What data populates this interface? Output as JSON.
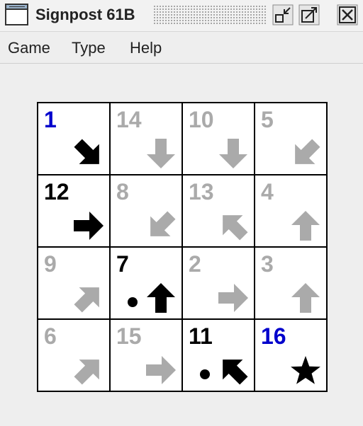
{
  "window": {
    "title": "Signpost 61B"
  },
  "menu": [
    "Game",
    "Type",
    "Help"
  ],
  "colors": {
    "given_number": "#0000cc",
    "placed_number": "#000000",
    "hint_number": "#aaaaaa",
    "given_arrow": "#000000",
    "hint_arrow": "#aaaaaa"
  },
  "board": {
    "cols": 4,
    "rows": 4,
    "cells": [
      {
        "num": "1",
        "kind": "given",
        "arrow": "se",
        "dot": false
      },
      {
        "num": "14",
        "kind": "hint",
        "arrow": "s",
        "dot": false
      },
      {
        "num": "10",
        "kind": "hint",
        "arrow": "s",
        "dot": false
      },
      {
        "num": "5",
        "kind": "hint",
        "arrow": "sw",
        "dot": false
      },
      {
        "num": "12",
        "kind": "placed",
        "arrow": "e",
        "dot": false
      },
      {
        "num": "8",
        "kind": "hint",
        "arrow": "sw",
        "dot": false
      },
      {
        "num": "13",
        "kind": "hint",
        "arrow": "nw",
        "dot": false
      },
      {
        "num": "4",
        "kind": "hint",
        "arrow": "n",
        "dot": false
      },
      {
        "num": "9",
        "kind": "hint",
        "arrow": "ne",
        "dot": false
      },
      {
        "num": "7",
        "kind": "placed",
        "arrow": "n",
        "dot": true
      },
      {
        "num": "2",
        "kind": "hint",
        "arrow": "e",
        "dot": false
      },
      {
        "num": "3",
        "kind": "hint",
        "arrow": "n",
        "dot": false
      },
      {
        "num": "6",
        "kind": "hint",
        "arrow": "ne",
        "dot": false
      },
      {
        "num": "15",
        "kind": "hint",
        "arrow": "e",
        "dot": false
      },
      {
        "num": "11",
        "kind": "placed",
        "arrow": "nw",
        "dot": true
      },
      {
        "num": "16",
        "kind": "given",
        "arrow": "star",
        "dot": false
      }
    ]
  }
}
